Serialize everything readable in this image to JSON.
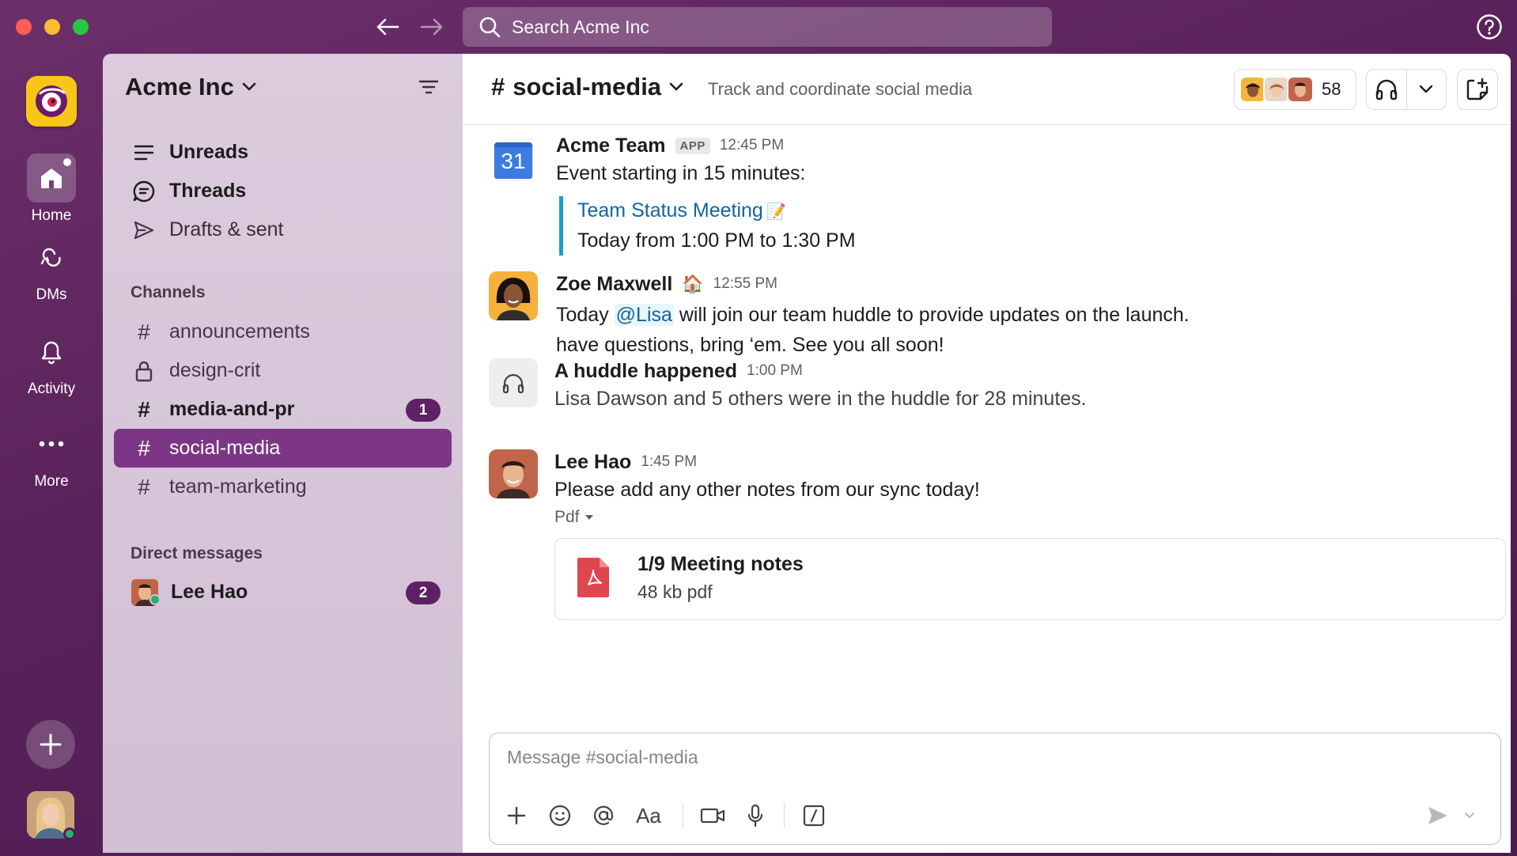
{
  "search": {
    "placeholder": "Search Acme Inc"
  },
  "rail": {
    "items": [
      {
        "label": "Home"
      },
      {
        "label": "DMs"
      },
      {
        "label": "Activity"
      },
      {
        "label": "More"
      }
    ]
  },
  "sidebar": {
    "workspace_name": "Acme Inc",
    "nav": [
      {
        "label": "Unreads"
      },
      {
        "label": "Threads"
      },
      {
        "label": "Drafts & sent"
      }
    ],
    "channels_heading": "Channels",
    "channels": [
      {
        "name": "announcements"
      },
      {
        "name": "design-crit"
      },
      {
        "name": "media-and-pr",
        "badge": "1"
      },
      {
        "name": "social-media"
      },
      {
        "name": "team-marketing"
      }
    ],
    "dm_heading": "Direct messages",
    "dms": [
      {
        "name": "Lee Hao",
        "badge": "2"
      }
    ]
  },
  "channel": {
    "name": "social-media",
    "hash": "#",
    "topic": "Track and coordinate social media",
    "member_count": "58"
  },
  "messages": {
    "m1": {
      "sender": "Acme Team",
      "tag": "APP",
      "time": "12:45 PM",
      "calendar_day": "31",
      "text": "Event starting in 15 minutes:",
      "event_title": "Team Status Meeting",
      "event_emoji": "📝",
      "event_time": "Today from 1:00 PM to 1:30 PM"
    },
    "m2": {
      "sender": "Zoe Maxwell",
      "status_emoji": "🏠",
      "time": "12:55 PM",
      "text_before": "Today ",
      "mention": "@Lisa",
      "text_after": " will join our team huddle to provide updates on the launch.",
      "text_line2": "have questions, bring ‘em. See you all soon!"
    },
    "m3": {
      "title": "A huddle happened",
      "time": "1:00 PM",
      "text": "Lisa Dawson and 5 others were in the huddle for 28 minutes."
    },
    "m4": {
      "sender": "Lee Hao",
      "time": "1:45 PM",
      "text": "Please add any other notes from our sync today!",
      "attachment_label": "Pdf",
      "file_name": "1/9 Meeting notes",
      "file_meta": "48 kb pdf"
    }
  },
  "composer": {
    "placeholder": "Message #social-media",
    "format_label": "Aa"
  },
  "colors": {
    "aubergine": "#5e2165",
    "active_channel": "#7d3686",
    "link": "#1264a3",
    "online": "#2bac76"
  }
}
